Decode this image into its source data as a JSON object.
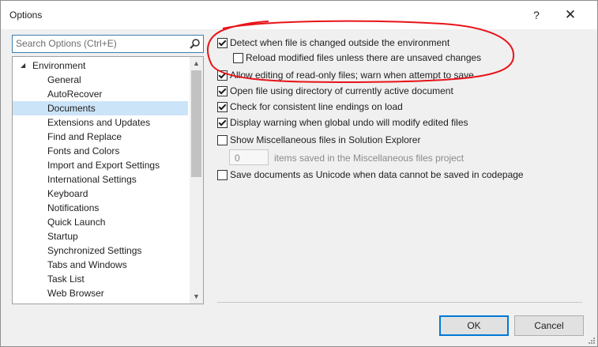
{
  "window": {
    "title": "Options",
    "help_glyph": "?",
    "close_glyph": "✕"
  },
  "search": {
    "placeholder": "Search Options (Ctrl+E)"
  },
  "tree": {
    "parent": "Environment",
    "items": [
      "General",
      "AutoRecover",
      "Documents",
      "Extensions and Updates",
      "Find and Replace",
      "Fonts and Colors",
      "Import and Export Settings",
      "International Settings",
      "Keyboard",
      "Notifications",
      "Quick Launch",
      "Startup",
      "Synchronized Settings",
      "Tabs and Windows",
      "Task List",
      "Web Browser"
    ],
    "selected": "Documents"
  },
  "options": {
    "detect_changes": {
      "label": "Detect when file is changed outside the environment",
      "checked": true
    },
    "reload_modified": {
      "label": "Reload modified files unless there are unsaved changes",
      "checked": false
    },
    "allow_readonly": {
      "label": "Allow editing of read-only files; warn when attempt to save",
      "checked": true
    },
    "open_file_dir": {
      "label": "Open file using directory of currently active document",
      "checked": true
    },
    "line_endings": {
      "label": "Check for consistent line endings on load",
      "checked": true
    },
    "global_undo": {
      "label": "Display warning when global undo will modify edited files",
      "checked": true
    },
    "show_misc": {
      "label": "Show Miscellaneous files in Solution Explorer",
      "checked": false
    },
    "misc_count": {
      "value": "0",
      "label": "items saved in the Miscellaneous files project"
    },
    "save_unicode": {
      "label": "Save documents as Unicode when data cannot be saved in codepage",
      "checked": false
    }
  },
  "buttons": {
    "ok": "OK",
    "cancel": "Cancel"
  },
  "colors": {
    "annotation": "#e8141a",
    "selection": "#cce4f7",
    "accent": "#0078d7"
  }
}
